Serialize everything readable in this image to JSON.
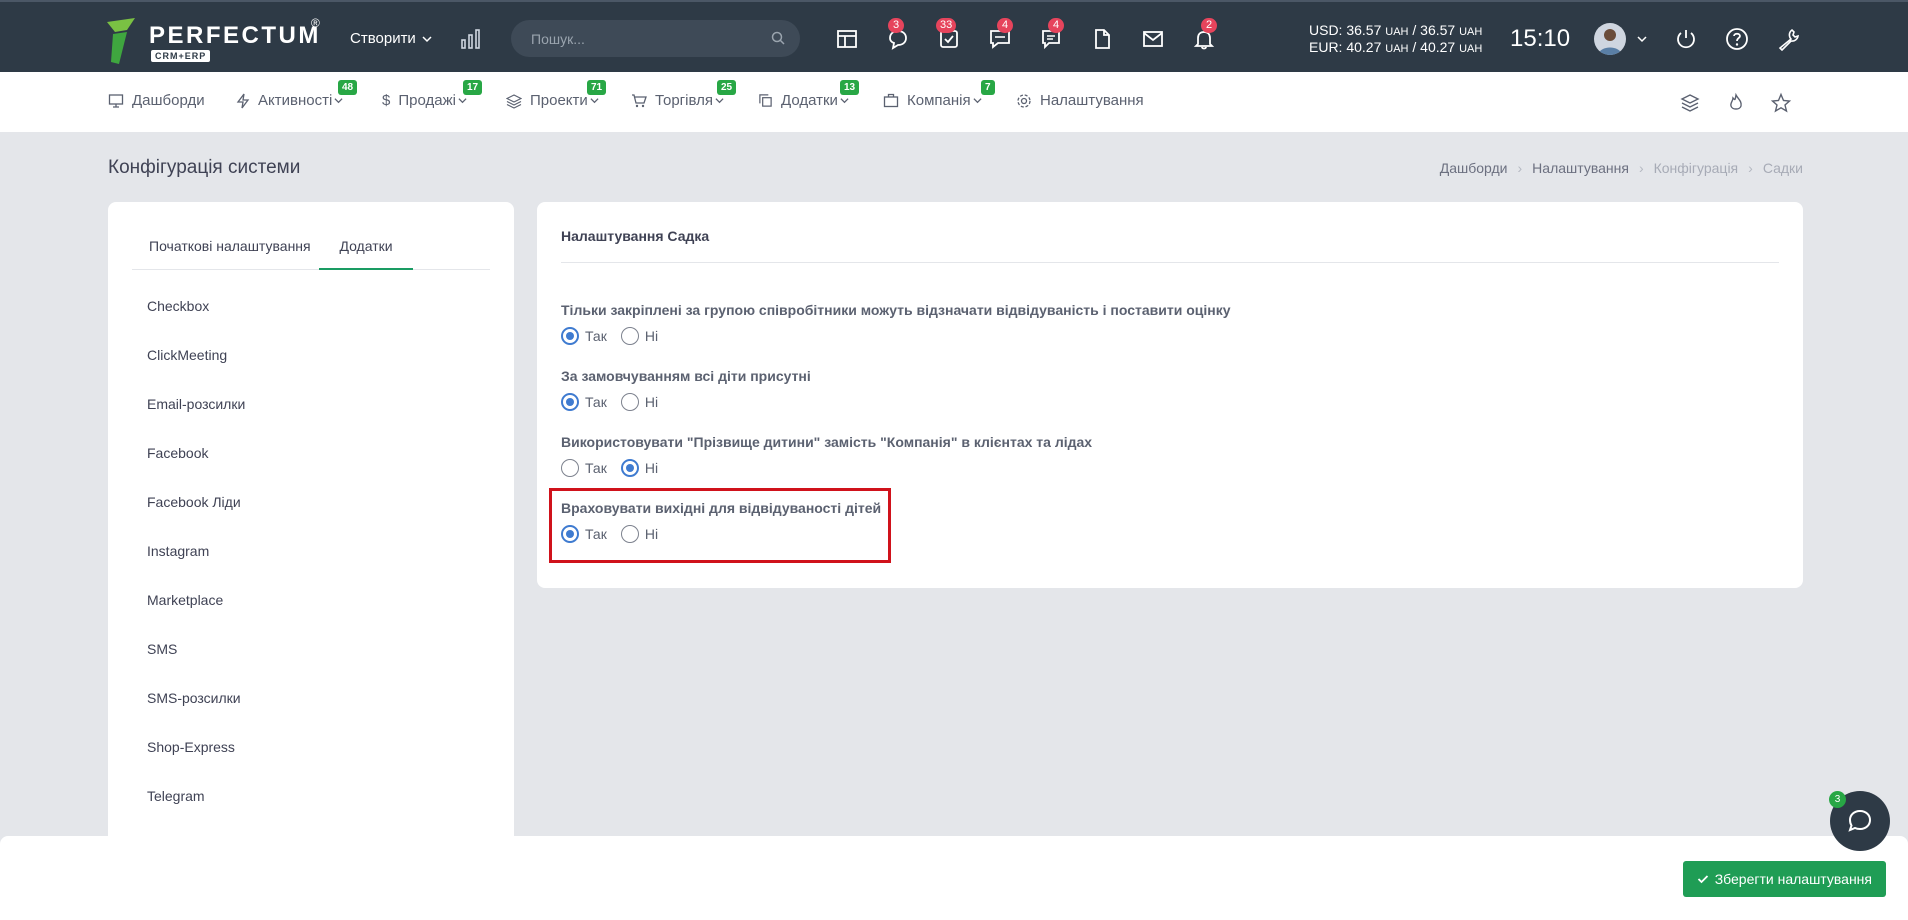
{
  "header": {
    "logo_text": "PERFECTUM",
    "logo_reg": "®",
    "logo_sub": "CRM+ERP",
    "create_label": "Створити",
    "search_placeholder": "Пошук...",
    "badges": {
      "chats": "3",
      "tasks": "33",
      "messages": "4",
      "comments": "4",
      "notifications": "2"
    },
    "rates": {
      "usd": "USD: 36.57",
      "usd_val": "36.57",
      "eur": "EUR: 40.27",
      "eur_val": "40.27",
      "unit": "UAH"
    },
    "time": "15:10"
  },
  "nav": {
    "items": [
      {
        "label": "Дашборди",
        "badge": ""
      },
      {
        "label": "Активності",
        "badge": "48"
      },
      {
        "label": "Продажі",
        "badge": "17"
      },
      {
        "label": "Проекти",
        "badge": "71"
      },
      {
        "label": "Торгівля",
        "badge": "25"
      },
      {
        "label": "Додатки",
        "badge": "13"
      },
      {
        "label": "Компанія",
        "badge": "7"
      },
      {
        "label": "Налаштування",
        "badge": ""
      }
    ]
  },
  "page": {
    "title": "Конфігурація системи",
    "breadcrumb": [
      "Дашборди",
      "Налаштування",
      "Конфігурація",
      "Садки"
    ]
  },
  "sidebar": {
    "tabs": [
      "Початкові налаштування",
      "Додатки"
    ],
    "items": [
      "Checkbox",
      "ClickMeeting",
      "Email-розсилки",
      "Facebook",
      "Facebook Ліди",
      "Instagram",
      "Marketplace",
      "SMS",
      "SMS-розсилки",
      "Shop-Express",
      "Telegram"
    ]
  },
  "settings": {
    "title": "Налаштування Садка",
    "yes": "Так",
    "no": "Ні",
    "questions": [
      {
        "text": "Тільки закріплені за групою співробітники можуть відзначати відвідуваність і поставити оцінку",
        "value": "Так"
      },
      {
        "text": "За замовчуванням всі діти присутні",
        "value": "Так"
      },
      {
        "text": "Використовувати \"Прізвище дитини\" замість \"Компанія\" в клієнтах та лідах",
        "value": "Ні"
      },
      {
        "text": "Враховувати вихідні для відвідуваності дітей",
        "value": "Так"
      }
    ]
  },
  "footer": {
    "save_label": "Зберегти налаштування",
    "chat_badge": "3"
  },
  "colors": {
    "topbar": "#2e3a46",
    "accent_green": "#1f9d55",
    "badge_red": "#e6445c",
    "radio_blue": "#3f7bd0",
    "highlight": "#d0121b"
  }
}
